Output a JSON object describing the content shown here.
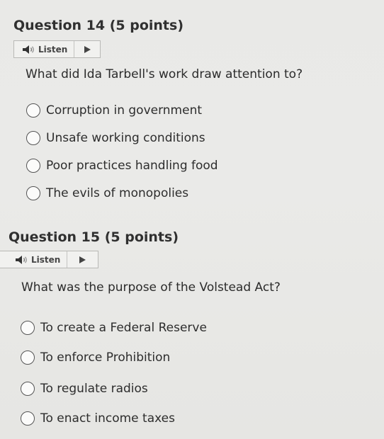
{
  "questions": [
    {
      "heading": "Question 14 (5 points)",
      "listen": "Listen",
      "prompt": "What did Ida Tarbell's work draw attention to?",
      "options": [
        "Corruption in government",
        "Unsafe working conditions",
        "Poor practices handling food",
        "The evils of monopolies"
      ]
    },
    {
      "heading": "Question 15 (5 points)",
      "listen": "Listen",
      "prompt": "What was the purpose of the Volstead Act?",
      "options": [
        "To create a Federal Reserve",
        "To enforce Prohibition",
        "To regulate radios",
        "To enact income taxes"
      ]
    }
  ],
  "icons": {
    "listen": "speaker-icon",
    "play": "play-icon"
  },
  "colors": {
    "background": "#e9e9e7",
    "text": "#2b2b2b",
    "radio_border": "#555555"
  }
}
